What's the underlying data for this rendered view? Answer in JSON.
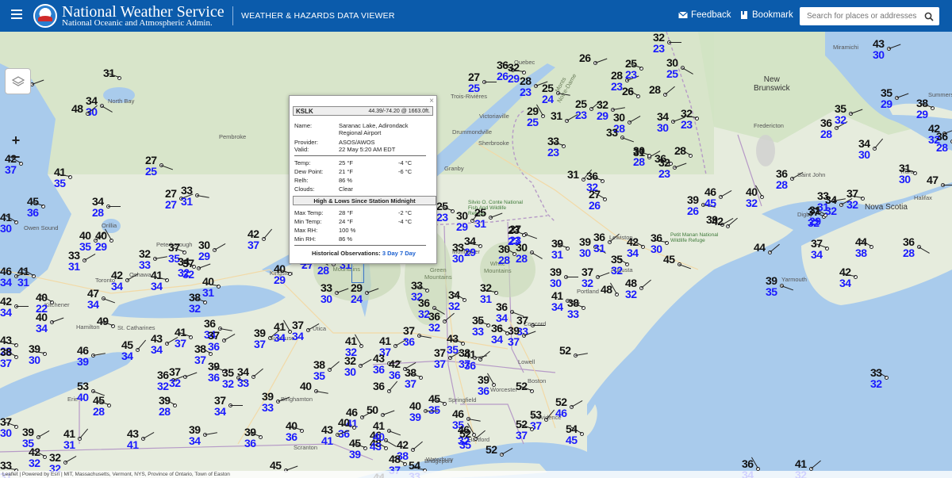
{
  "header": {
    "title": "National Weather Service",
    "subtitle": "National Oceanic and Atmospheric Admin.",
    "app_title": "WEATHER & HAZARDS DATA VIEWER",
    "feedback_label": "Feedback",
    "bookmark_label": "Bookmark",
    "search_placeholder": "Search for places or addresses"
  },
  "zoom": {
    "in": "+",
    "out": "−"
  },
  "popup": {
    "station_id": "KSLK",
    "coords": "44.39/-74.20 @ 1663.0ft.",
    "name_label": "Name:",
    "name_value": "Saranac Lake, Adirondack Regional Airport",
    "provider_label": "Provider:",
    "provider_value": "ASOS/AWOS",
    "valid_label": "Valid:",
    "valid_value": "22 May 5:20 AM EDT",
    "temp_label": "Temp:",
    "temp_f": "25 °F",
    "temp_c": "-4 °C",
    "dew_label": "Dew Point:",
    "dew_f": "21 °F",
    "dew_c": "-6 °C",
    "relh_label": "Relh:",
    "relh_value": "86 %",
    "clouds_label": "Clouds:",
    "clouds_value": "Clear",
    "hl_title": "High & Lows Since Station Midnight",
    "max_temp_label": "Max Temp:",
    "max_temp_f": "28 °F",
    "max_temp_c": "-2 °C",
    "min_temp_label": "Min Temp:",
    "min_temp_f": "24 °F",
    "min_temp_c": "-4 °C",
    "max_rh_label": "Max RH:",
    "max_rh_value": "100 %",
    "min_rh_label": "Min RH:",
    "min_rh_value": "86 %",
    "hist_label": "Historical Observations:",
    "hist_3day": "3 Day",
    "hist_7day": "7 Day"
  },
  "places": [
    "North Bay",
    "Pembroke",
    "Orillia",
    "Owen Sound",
    "Peterborough",
    "Kingston",
    "Oshawa",
    "Toronto",
    "Kitchener",
    "Hamilton",
    "St. Catharines",
    "Erie",
    "Syracuse",
    "Utica",
    "Binghamton",
    "Scranton",
    "Trois-Rivières",
    "Victoriaville",
    "Drummondville",
    "Granby",
    "Sherbrooke",
    "Quebec",
    "Fredericton",
    "Saint John",
    "Truro",
    "Halifax",
    "Digby",
    "Yarmouth",
    "Augusta",
    "Portland",
    "Concord",
    "Lowell",
    "Boston",
    "Worcester",
    "Springfield",
    "Hartford",
    "Providence",
    "Waterbury",
    "Bridgeport",
    "Montpelier",
    "Lewiston",
    "Miramichi",
    "Summerside"
  ],
  "provinces": [
    "New Brunswick",
    "Nova Scotia"
  ],
  "park_label": "Silvio O. Conte National Fish And Wildlife Refuge",
  "refuge_label": "Petit Manan National Wildlife Refuge",
  "mountains": [
    "Adirondack Mountains",
    "Green Mountains",
    "White Mountains",
    "Monts Notre-Dame"
  ],
  "stations": [
    [
      "37",
      "30"
    ],
    [
      "31",
      ""
    ],
    [
      "34",
      "30"
    ],
    [
      "48",
      ""
    ],
    [
      "42",
      "37"
    ],
    [
      "41",
      "35"
    ],
    [
      "27",
      "25"
    ],
    [
      "45",
      "36"
    ],
    [
      "41",
      "30"
    ],
    [
      "34",
      "28"
    ],
    [
      "27",
      "27"
    ],
    [
      "33",
      "31"
    ],
    [
      "40",
      "35"
    ],
    [
      "40",
      "29"
    ],
    [
      "33",
      "31"
    ],
    [
      "32",
      "33"
    ],
    [
      "37",
      "35"
    ],
    [
      "30",
      "29"
    ],
    [
      "42",
      "37"
    ],
    [
      "34",
      "32"
    ],
    [
      "41",
      "31"
    ],
    [
      "42",
      "34"
    ],
    [
      "41",
      "34"
    ],
    [
      "37",
      "32"
    ],
    [
      "46",
      "34"
    ],
    [
      "40",
      "29"
    ],
    [
      "28",
      "27"
    ],
    [
      "31",
      "28"
    ],
    [
      "32",
      "31"
    ],
    [
      "40",
      "31"
    ],
    [
      "47",
      "34"
    ],
    [
      "38",
      "32"
    ],
    [
      "40",
      "22"
    ],
    [
      "42",
      "34"
    ],
    [
      "40",
      "34"
    ],
    [
      "36",
      "34"
    ],
    [
      "39",
      "37"
    ],
    [
      "41",
      "34"
    ],
    [
      "37",
      "34"
    ],
    [
      "46",
      "39"
    ],
    [
      "49",
      ""
    ],
    [
      "43",
      "34"
    ],
    [
      "45",
      "34"
    ],
    [
      "41",
      "37"
    ],
    [
      "38",
      "37"
    ],
    [
      "37",
      "36"
    ],
    [
      "43",
      "28"
    ],
    [
      "36",
      "32"
    ],
    [
      "37",
      "32"
    ],
    [
      "39",
      "36"
    ],
    [
      "35",
      "32"
    ],
    [
      "34",
      "33"
    ],
    [
      "38",
      "37"
    ],
    [
      "39",
      "30"
    ],
    [
      "53",
      "40"
    ],
    [
      "45",
      "28"
    ],
    [
      "39",
      "28"
    ],
    [
      "37",
      "34"
    ],
    [
      "39",
      "33"
    ],
    [
      "40",
      ""
    ],
    [
      "38",
      "35"
    ],
    [
      "41",
      "32"
    ],
    [
      "41",
      "37"
    ],
    [
      "43",
      "36"
    ],
    [
      "38",
      "37"
    ],
    [
      "42",
      "36"
    ],
    [
      "36",
      ""
    ],
    [
      "40",
      "36"
    ],
    [
      "48",
      ""
    ],
    [
      "46",
      "41"
    ],
    [
      "40",
      "36"
    ],
    [
      "50",
      ""
    ],
    [
      "43",
      "41"
    ],
    [
      "45",
      "39"
    ],
    [
      "46",
      "43"
    ],
    [
      "42",
      "38"
    ],
    [
      "48",
      "37"
    ],
    [
      "54",
      "33"
    ],
    [
      "41",
      "40"
    ],
    [
      "45",
      "35"
    ],
    [
      "44",
      ""
    ],
    [
      "40",
      "39"
    ],
    [
      "45",
      ""
    ],
    [
      "46",
      "35"
    ],
    [
      "52",
      "35"
    ],
    [
      "46",
      "32"
    ],
    [
      "43",
      "41"
    ],
    [
      "39",
      "34"
    ],
    [
      "39",
      "36"
    ],
    [
      "39",
      "35"
    ],
    [
      "41",
      "31"
    ],
    [
      "37",
      "30"
    ],
    [
      "42",
      "32"
    ],
    [
      "32",
      "32"
    ],
    [
      "33",
      "31"
    ],
    [
      "29",
      "24"
    ],
    [
      "33",
      "30"
    ],
    [
      "33",
      "32"
    ],
    [
      "36",
      "32"
    ],
    [
      "36",
      "32"
    ],
    [
      "34",
      "32"
    ],
    [
      "32",
      "31"
    ],
    [
      "36",
      "34"
    ],
    [
      "35",
      "33"
    ],
    [
      "36",
      "34"
    ],
    [
      "37",
      "33"
    ],
    [
      "39",
      "37"
    ],
    [
      "37",
      "36"
    ],
    [
      "41",
      "36"
    ],
    [
      "39",
      "36"
    ],
    [
      "37",
      "37"
    ],
    [
      "38",
      "37"
    ],
    [
      "43",
      "35"
    ],
    [
      "32",
      "30"
    ],
    [
      "30",
      "29"
    ],
    [
      "25",
      "23"
    ],
    [
      "33",
      "30"
    ],
    [
      "31",
      "30"
    ],
    [
      "29",
      "27"
    ],
    [
      "25",
      "31"
    ],
    [
      "28",
      "27"
    ],
    [
      "36",
      "30"
    ],
    [
      "30",
      "28"
    ],
    [
      "27",
      "25"
    ],
    [
      "30",
      "28"
    ],
    [
      "34",
      "29"
    ],
    [
      "27",
      "23"
    ],
    [
      "23",
      "23"
    ],
    [
      "36",
      "26"
    ],
    [
      "27",
      "25"
    ],
    [
      "28",
      "23"
    ],
    [
      "25",
      "24"
    ],
    [
      "25",
      "23"
    ],
    [
      "29",
      "25"
    ],
    [
      "31",
      ""
    ],
    [
      "32",
      "29"
    ],
    [
      "33",
      "23"
    ],
    [
      "30",
      "28"
    ],
    [
      "31",
      ""
    ],
    [
      "36",
      "32"
    ],
    [
      "27",
      "26"
    ],
    [
      "31",
      ""
    ],
    [
      "36",
      ""
    ],
    [
      "32",
      "23"
    ],
    [
      "34",
      "30"
    ],
    [
      "39",
      "31"
    ],
    [
      "39",
      "30"
    ],
    [
      "36",
      "31"
    ],
    [
      "42",
      "34"
    ],
    [
      "36",
      "30"
    ],
    [
      "45",
      ""
    ],
    [
      "38",
      "33"
    ],
    [
      "35",
      "32"
    ],
    [
      "39",
      "30"
    ],
    [
      "37",
      "32"
    ],
    [
      "41",
      "34"
    ],
    [
      "48",
      "32"
    ],
    [
      "48",
      ""
    ],
    [
      "39",
      ""
    ],
    [
      "52",
      ""
    ],
    [
      "52",
      ""
    ],
    [
      "52",
      "46"
    ],
    [
      "53",
      "37"
    ],
    [
      "52",
      "37"
    ],
    [
      "54",
      "45"
    ],
    [
      "52",
      ""
    ],
    [
      "32",
      "29"
    ],
    [
      "28",
      "23"
    ],
    [
      "26",
      ""
    ],
    [
      "25",
      "23"
    ],
    [
      "30",
      "25"
    ],
    [
      "28",
      ""
    ],
    [
      "26",
      ""
    ],
    [
      "32",
      "23"
    ],
    [
      "33",
      ""
    ],
    [
      "30",
      "28"
    ],
    [
      "28",
      ""
    ],
    [
      "32",
      "23"
    ],
    [
      "43",
      "30"
    ],
    [
      "39",
      "26"
    ],
    [
      "42",
      ""
    ],
    [
      "40",
      "32"
    ],
    [
      "36",
      "28"
    ],
    [
      "33",
      "31"
    ],
    [
      "37",
      "32"
    ],
    [
      "36",
      "28"
    ],
    [
      "34",
      "30"
    ],
    [
      "31",
      "30"
    ],
    [
      "31",
      "29"
    ],
    [
      "34",
      "32"
    ],
    [
      "37",
      "32"
    ],
    [
      "35",
      "32"
    ],
    [
      "35",
      "29"
    ],
    [
      "38",
      "29"
    ],
    [
      "36",
      "28"
    ],
    [
      "44",
      ""
    ],
    [
      "44",
      "38"
    ],
    [
      "42",
      "34"
    ],
    [
      "39",
      "35"
    ],
    [
      "37",
      "34"
    ],
    [
      "33",
      "32"
    ],
    [
      "47",
      ""
    ],
    [
      "42",
      "32"
    ],
    [
      "36",
      "28"
    ],
    [
      "41",
      "32"
    ],
    [
      "36",
      "34"
    ],
    [
      "46",
      "45"
    ],
    [
      "47",
      ""
    ],
    [
      "30",
      "28"
    ]
  ]
}
